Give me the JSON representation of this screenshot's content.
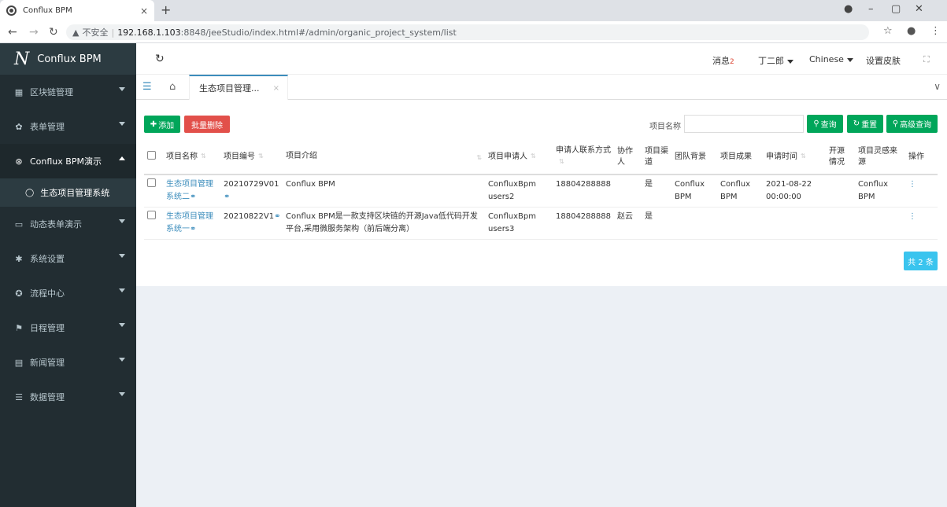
{
  "browser": {
    "tab_title": "Conflux BPM",
    "tab_close": "×",
    "new_tab": "+",
    "insecure_label": "不安全",
    "url_host": "192.168.1.103",
    "url_path": ":8848/jeeStudio/index.html#/admin/organic_project_system/list"
  },
  "sidebar": {
    "logo_mark": "N",
    "logo_text": "Conflux BPM",
    "items": [
      {
        "label": "区块链管理",
        "icon": "▦"
      },
      {
        "label": "表单管理",
        "icon": "✿"
      },
      {
        "label": "Conflux BPM演示",
        "icon": "⊛"
      },
      {
        "label": "生态项目管理系统",
        "icon": "◯"
      },
      {
        "label": "动态表单演示",
        "icon": "▭"
      },
      {
        "label": "系统设置",
        "icon": "✱"
      },
      {
        "label": "流程中心",
        "icon": "✪"
      },
      {
        "label": "日程管理",
        "icon": "⚑"
      },
      {
        "label": "新闻管理",
        "icon": "▤"
      },
      {
        "label": "数据管理",
        "icon": "☰"
      }
    ]
  },
  "topbar": {
    "messages_label": "消息",
    "messages_count": "2",
    "user": "丁二郎",
    "language": "Chinese",
    "skin": "设置皮肤"
  },
  "tabs": {
    "active_tab": "生态项目管理...",
    "close": "×"
  },
  "toolbar": {
    "add": "添加",
    "batch_delete": "批量删除",
    "search_label": "项目名称",
    "search_value": "",
    "query": "查询",
    "reset": "重置",
    "advanced": "高级查询"
  },
  "table": {
    "headers": [
      "项目名称",
      "项目编号",
      "项目介绍",
      "项目申请人",
      "申请人联系方式",
      "协作人",
      "项目渠道",
      "团队背景",
      "项目成果",
      "申请时间",
      "开源情况",
      "项目灵感来源",
      "操作"
    ],
    "rows": [
      {
        "name": "生态项目管理系统二",
        "code": "20210729V01",
        "intro": "Conflux BPM",
        "applicant": "ConfluxBpm users2",
        "phone": "18804288888",
        "collaborator": "",
        "channel": "是",
        "team": "Conflux BPM",
        "result": "Conflux BPM",
        "time": "2021-08-22 00:00:00",
        "opensource": "",
        "inspiration": "Conflux BPM"
      },
      {
        "name": "生态项目管理系统一",
        "code": "20210822V1",
        "intro": "Conflux BPM是一款支持区块链的开源Java低代码开发平台,采用微服务架构（前后端分离）",
        "applicant": "ConfluxBpm users3",
        "phone": "18804288888",
        "collaborator": "赵云",
        "channel": "是",
        "team": "",
        "result": "",
        "time": "",
        "opensource": "",
        "inspiration": ""
      }
    ]
  },
  "pagination": {
    "total": "共 2 条"
  },
  "colors": {
    "sidebar_bg": "#222d32",
    "accent": "#3c8dbc",
    "green": "#00a65a",
    "red": "#e2504a",
    "info": "#3ac4ee"
  }
}
